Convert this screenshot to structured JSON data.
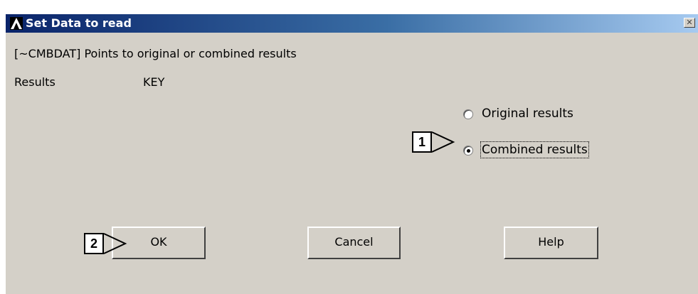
{
  "window": {
    "title": "Set Data to read",
    "close_glyph": "✕"
  },
  "header": {
    "description": "[~CMBDAT] Points to original or combined results",
    "field_label": "Results",
    "field_key": "KEY"
  },
  "options": [
    {
      "label": "Original results",
      "selected": false
    },
    {
      "label": "Combined results",
      "selected": true
    }
  ],
  "buttons": {
    "ok": "OK",
    "cancel": "Cancel",
    "help": "Help"
  },
  "callouts": {
    "one": "1",
    "two": "2"
  }
}
